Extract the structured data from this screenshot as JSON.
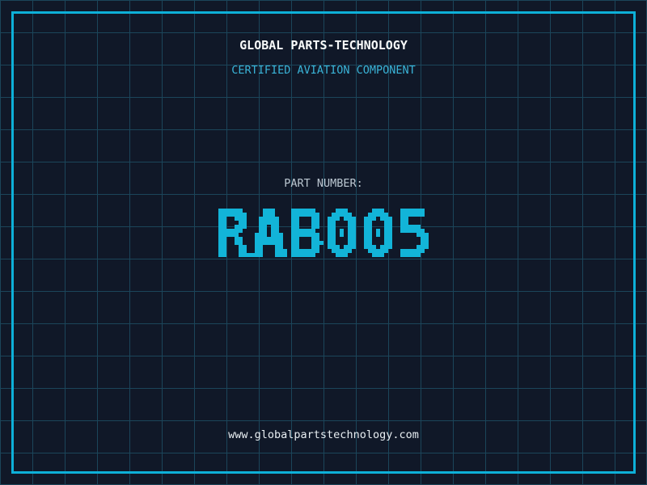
{
  "header": {
    "company_name": "GLOBAL PARTS-TECHNOLOGY",
    "certification_label": "CERTIFIED AVIATION COMPONENT"
  },
  "part_number": {
    "label": "PART NUMBER:",
    "value": "RAB005"
  },
  "footer": {
    "website": "www.globalpartstechnology.com"
  },
  "colors": {
    "background": "#101828",
    "grid_line": "#1b455a",
    "frame_border": "#0db0d8",
    "company_text": "#f8fafa",
    "certification_text": "#3ab4d8",
    "part_label_text": "#bcc8d2",
    "part_number_text": "#12b4d8",
    "website_text": "#e8eef2"
  }
}
